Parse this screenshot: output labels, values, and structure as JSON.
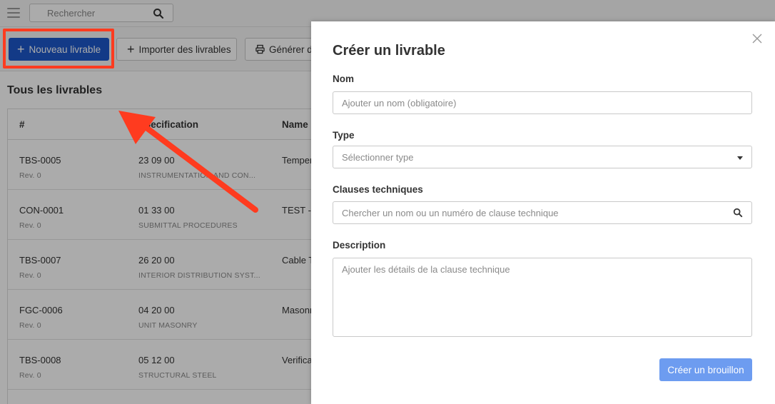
{
  "topbar": {
    "search_placeholder": "Rechercher"
  },
  "toolbar": {
    "new_label": "Nouveau livrable",
    "import_label": "Importer des livrables",
    "generate_label": "Générer des"
  },
  "section_title": "Tous les livrables",
  "table": {
    "columns": [
      "#",
      "Specification",
      "Name"
    ],
    "rows": [
      {
        "id": "TBS-0005",
        "rev": "Rev. 0",
        "spec_code": "23 09 00",
        "spec_name": "INSTRUMENTATION AND CON...",
        "name": "Temper"
      },
      {
        "id": "CON-0001",
        "rev": "Rev. 0",
        "spec_code": "01 33 00",
        "spec_name": "SUBMITTAL PROCEDURES",
        "name": "TEST - C"
      },
      {
        "id": "TBS-0007",
        "rev": "Rev. 0",
        "spec_code": "26 20 00",
        "spec_name": "INTERIOR DISTRIBUTION SYST...",
        "name": "Cable T"
      },
      {
        "id": "FGC-0006",
        "rev": "Rev. 0",
        "spec_code": "04 20 00",
        "spec_name": "UNIT MASONRY",
        "name": "Masonr"
      },
      {
        "id": "TBS-0008",
        "rev": "Rev. 0",
        "spec_code": "05 12 00",
        "spec_name": "STRUCTURAL STEEL",
        "name": "Verifica"
      }
    ]
  },
  "modal": {
    "title": "Créer un livrable",
    "name_label": "Nom",
    "name_placeholder": "Ajouter un nom (obligatoire)",
    "type_label": "Type",
    "type_placeholder": "Sélectionner type",
    "clauses_label": "Clauses techniques",
    "clauses_placeholder": "Chercher un nom ou un numéro de clause technique",
    "description_label": "Description",
    "description_placeholder": "Ajouter les détails de la clause technique",
    "submit_label": "Créer un brouillon"
  },
  "colors": {
    "primary": "#1d57c9",
    "highlight": "#ff3b1f",
    "draft_button": "#6d9cf0"
  }
}
